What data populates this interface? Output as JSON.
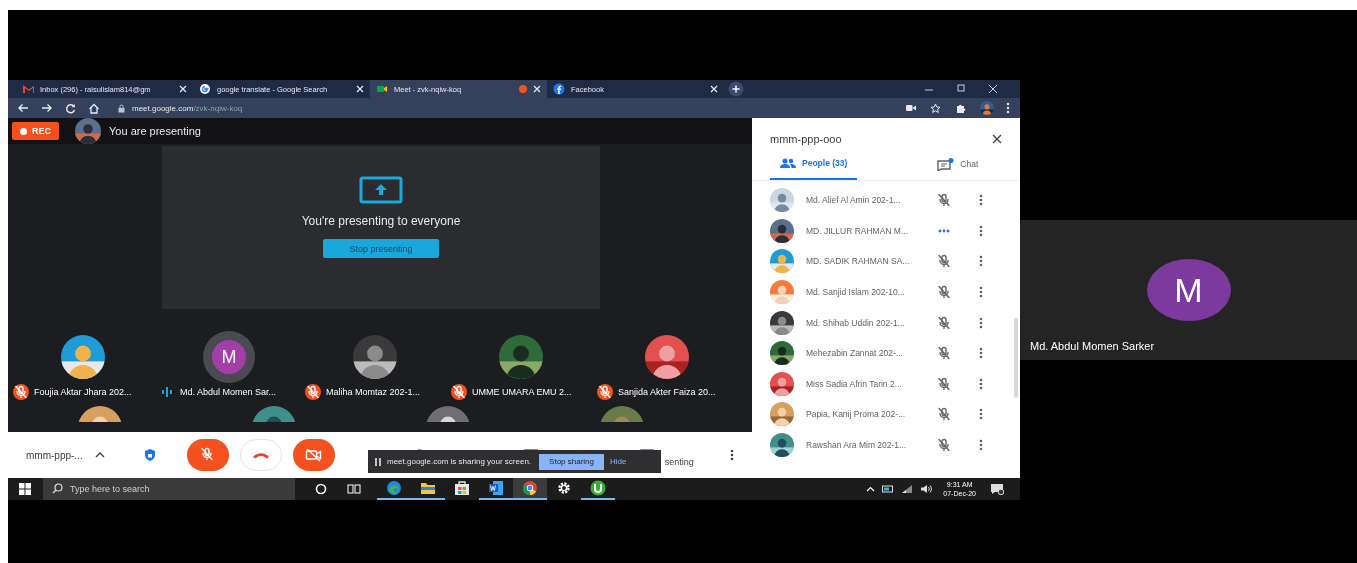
{
  "browser": {
    "tabs": [
      {
        "label": "Inbox (296) - raisulislam814@gm",
        "kind": "gmail",
        "selected": false,
        "recording": false
      },
      {
        "label": "google translate - Google Search",
        "kind": "google",
        "selected": false,
        "recording": false
      },
      {
        "label": "Meet - zvk-nqiw-koq",
        "kind": "meet",
        "selected": true,
        "recording": true
      },
      {
        "label": "Facebook",
        "kind": "facebook",
        "selected": false,
        "recording": false
      }
    ],
    "url_host": "meet.google.com",
    "url_path": "/zvk-nqiw-koq"
  },
  "meet": {
    "rec_label": "REC",
    "presenting_banner": "You are presenting",
    "present_card": {
      "message": "You're presenting to everyone",
      "button": "Stop presenting"
    },
    "tiles": [
      {
        "name": "Foujia Aktar Jhara 202...",
        "kind": "picture",
        "muted": true
      },
      {
        "name": "Md. Abdul Momen Sar...",
        "kind": "letter",
        "letter": "M",
        "color": "#a33ea9",
        "muted": false
      },
      {
        "name": "Maliha Momtaz 202-1...",
        "kind": "picture",
        "muted": true
      },
      {
        "name": "UMME UMARA EMU 2...",
        "kind": "picture",
        "muted": true
      },
      {
        "name": "Sanjida Akter Faiza 20...",
        "kind": "picture",
        "muted": true
      }
    ],
    "meeting_code": "mmm-ppp-...",
    "control_text": "senting",
    "share_notice": {
      "message": "meet.google.com is sharing your screen.",
      "stop": "Stop sharing",
      "hide": "Hide"
    }
  },
  "sidebar": {
    "title": "mmm-ppp-ooo",
    "tabs": [
      {
        "label": "People (33)",
        "kind": "people",
        "selected": true
      },
      {
        "label": "Chat",
        "kind": "chat",
        "selected": false
      }
    ],
    "people": [
      {
        "name": "Md. Alief Al Amin 202-1...",
        "muted": true
      },
      {
        "name": "MD. JILLUR RAHMAN M...",
        "muted": false
      },
      {
        "name": "MD. SADIK RAHMAN SA...",
        "muted": true
      },
      {
        "name": "Md. Sanjid Islam 202-10...",
        "muted": true
      },
      {
        "name": "Md. Shihab Uddin 202-1...",
        "muted": true
      },
      {
        "name": "Mehezabin Zannat 202-...",
        "muted": true
      },
      {
        "name": "Miss Sadia Afrin Tarin 2...",
        "muted": true
      },
      {
        "name": "Papia, Kanij Proma 202-...",
        "muted": true
      },
      {
        "name": "Rawshan Ara Mim 202-1...",
        "muted": true
      }
    ]
  },
  "taskbar": {
    "search_placeholder": "Type here to search",
    "apps": [
      {
        "kind": "edge",
        "running": true,
        "active": false
      },
      {
        "kind": "explorer",
        "running": true,
        "active": false
      },
      {
        "kind": "store",
        "running": false,
        "active": false
      },
      {
        "kind": "word",
        "running": true,
        "active": false
      },
      {
        "kind": "chrome",
        "running": true,
        "active": true
      },
      {
        "kind": "settings",
        "running": false,
        "active": false
      },
      {
        "kind": "torrent",
        "running": true,
        "active": false
      }
    ],
    "time": "9:31 AM",
    "date": "07-Dec-20"
  },
  "spotlight": {
    "letter": "M",
    "color": "#7c3a9e",
    "name": "Md. Abdul Momen Sarker"
  }
}
